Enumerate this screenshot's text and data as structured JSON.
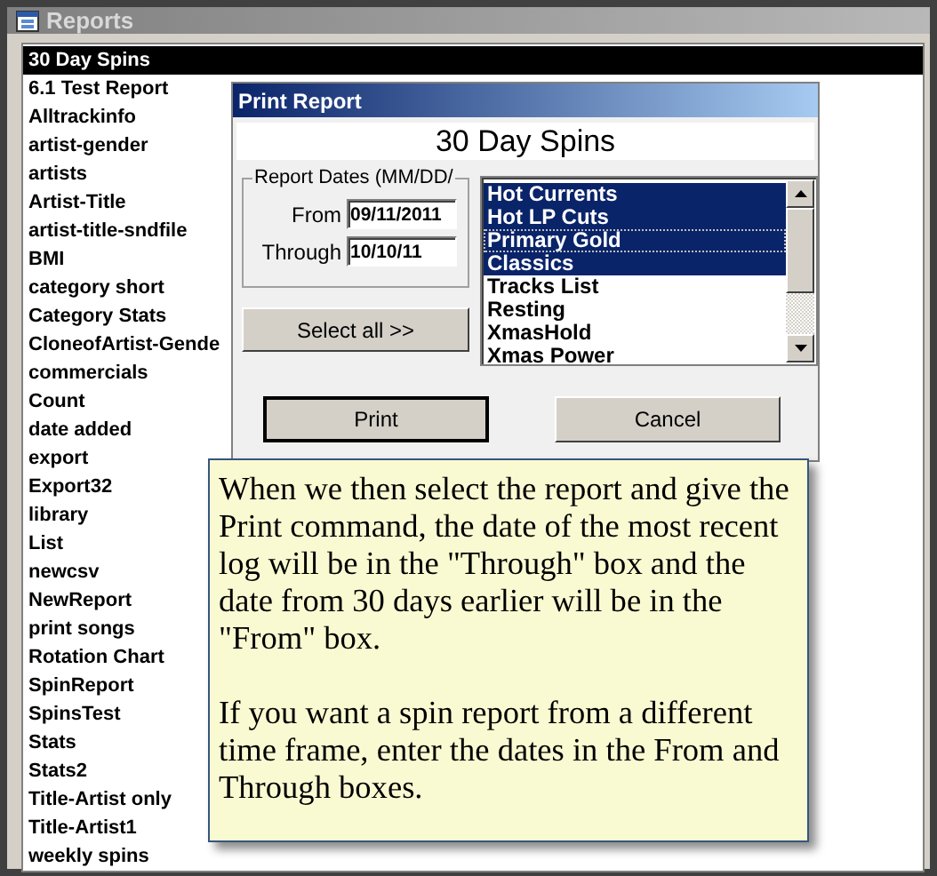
{
  "window": {
    "title": "Reports"
  },
  "reports": [
    {
      "label": "30 Day Spins",
      "selected": true
    },
    {
      "label": "6.1 Test Report",
      "selected": false
    },
    {
      "label": "Alltrackinfo",
      "selected": false
    },
    {
      "label": "artist-gender",
      "selected": false
    },
    {
      "label": "artists",
      "selected": false
    },
    {
      "label": "Artist-Title",
      "selected": false
    },
    {
      "label": "artist-title-sndfile",
      "selected": false
    },
    {
      "label": "BMI",
      "selected": false
    },
    {
      "label": "category short",
      "selected": false
    },
    {
      "label": "Category Stats",
      "selected": false
    },
    {
      "label": "CloneofArtist-Gende",
      "selected": false
    },
    {
      "label": "commercials",
      "selected": false
    },
    {
      "label": "Count",
      "selected": false
    },
    {
      "label": "date added",
      "selected": false
    },
    {
      "label": "export",
      "selected": false
    },
    {
      "label": "Export32",
      "selected": false
    },
    {
      "label": "library",
      "selected": false
    },
    {
      "label": "List",
      "selected": false
    },
    {
      "label": "newcsv",
      "selected": false
    },
    {
      "label": "NewReport",
      "selected": false
    },
    {
      "label": "print songs",
      "selected": false
    },
    {
      "label": "Rotation Chart",
      "selected": false
    },
    {
      "label": "SpinReport",
      "selected": false
    },
    {
      "label": "SpinsTest",
      "selected": false
    },
    {
      "label": "Stats",
      "selected": false
    },
    {
      "label": "Stats2",
      "selected": false
    },
    {
      "label": "Title-Artist only",
      "selected": false
    },
    {
      "label": "Title-Artist1",
      "selected": false
    },
    {
      "label": "weekly spins",
      "selected": false
    }
  ],
  "dialog": {
    "title": "Print Report",
    "report_name": "30 Day Spins",
    "dates_group": "Report Dates (MM/DD/",
    "from_label": "From",
    "from_value": "09/11/2011",
    "through_label": "Through",
    "through_value": "10/10/11",
    "select_all": "Select all >>",
    "categories": [
      {
        "label": "Hot Currents",
        "selected": true,
        "focused": false
      },
      {
        "label": "Hot LP Cuts",
        "selected": true,
        "focused": false
      },
      {
        "label": "Primary Gold",
        "selected": true,
        "focused": true
      },
      {
        "label": "Classics",
        "selected": true,
        "focused": false
      },
      {
        "label": "Tracks List",
        "selected": false,
        "focused": false
      },
      {
        "label": "Resting",
        "selected": false,
        "focused": false
      },
      {
        "label": "XmasHold",
        "selected": false,
        "focused": false
      },
      {
        "label": "Xmas Power",
        "selected": false,
        "focused": false
      }
    ],
    "print": "Print",
    "cancel": "Cancel"
  },
  "callout": {
    "paragraphs": [
      "When we then select the report and give the Print command, the date of the most recent log will be in the \"Through\" box and the date from 30 days earlier will be in the \"From\" box.",
      "If you want a spin report from a different time frame, enter the dates in the From and Through boxes."
    ]
  }
}
